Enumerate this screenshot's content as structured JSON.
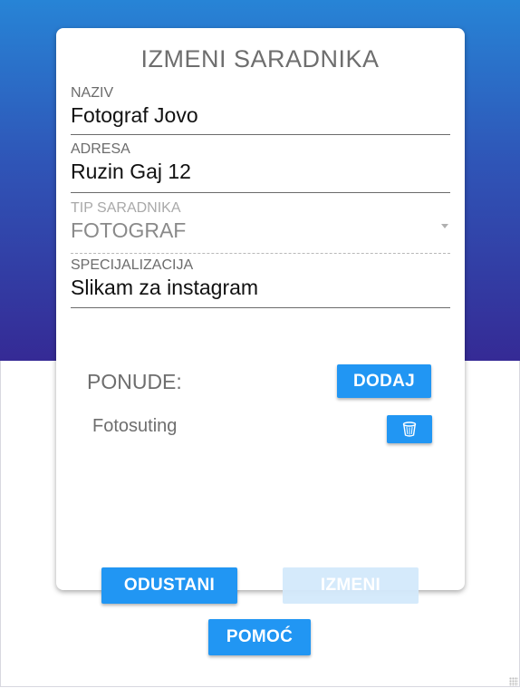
{
  "form": {
    "title": "IZMENI SARADNIKA",
    "naziv": {
      "label": "NAZIV",
      "value": "Fotograf Jovo"
    },
    "adresa": {
      "label": "ADRESA",
      "value": "Ruzin Gaj 12"
    },
    "tip": {
      "label": "TIP SARADNIKA",
      "value": "FOTOGRAF"
    },
    "specijalizacija": {
      "label": "SPECIJALIZACIJA",
      "value": "Slikam za instagram"
    }
  },
  "offers": {
    "label": "PONUDE:",
    "add_label": "DODAJ",
    "items": [
      {
        "name": "Fotosuting",
        "delete_icon": "trash-icon"
      }
    ]
  },
  "actions": {
    "cancel_label": "ODUSTANI",
    "submit_label": "IZMENI",
    "help_label": "POMOĆ"
  },
  "colors": {
    "primary": "#2196f3",
    "primary_disabled": "#d3e9fb",
    "header_gradient_top": "#2784d6",
    "header_gradient_bottom": "#352a95"
  }
}
